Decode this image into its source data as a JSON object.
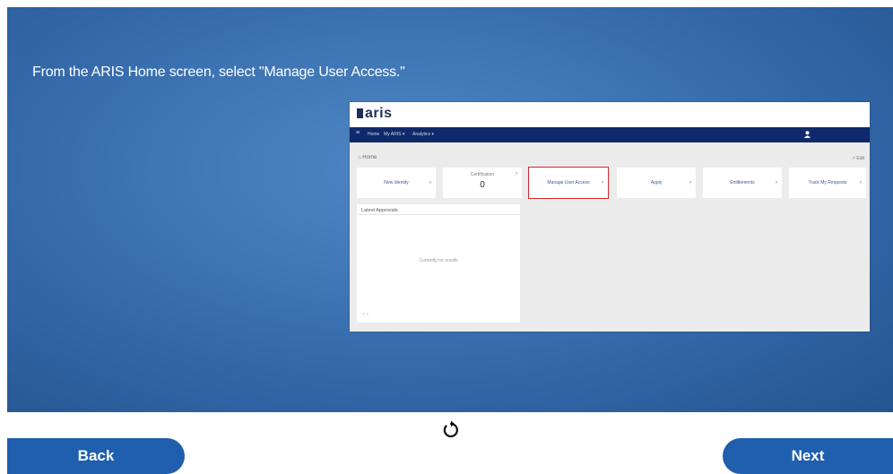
{
  "instruction": "From the ARIS Home screen, select \"Manage User Access.\"",
  "screenshot": {
    "logo": "aris",
    "nav": {
      "items": [
        "Home",
        "My ARIS ▾",
        "Analytics ▾"
      ]
    },
    "breadcrumb": "Home",
    "corner_text": "↗ Edit",
    "tiles": [
      {
        "label": "New Identity"
      },
      {
        "top": "Certification",
        "number": "0"
      },
      {
        "label": "Manage User Access",
        "highlight": true
      },
      {
        "label": "Apply"
      },
      {
        "label": "Entitlements"
      },
      {
        "label": "Track My Requests"
      }
    ],
    "panel": {
      "title": "Latest Approvals",
      "empty": "Currently no results",
      "footer": "< >"
    }
  },
  "buttons": {
    "back": "Back",
    "next": "Next"
  },
  "icons": {
    "replay": "replay-icon"
  }
}
